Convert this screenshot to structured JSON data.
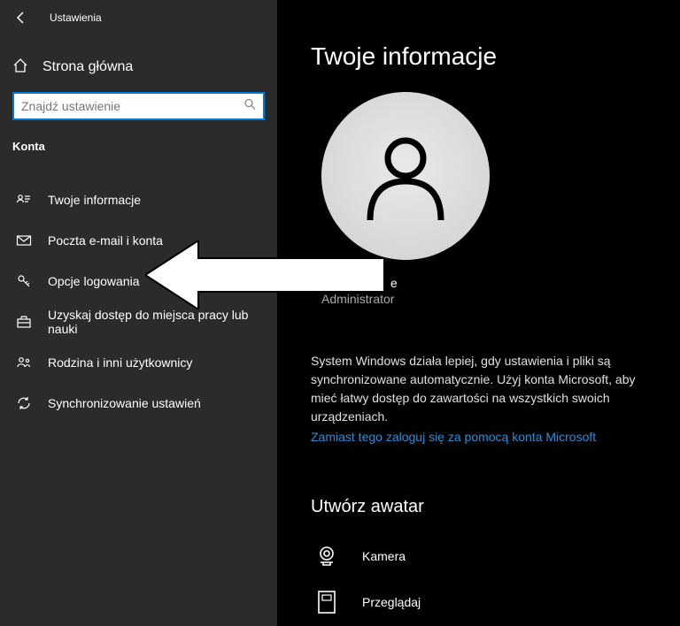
{
  "titlebar": {
    "title": "Ustawienia"
  },
  "home": {
    "label": "Strona główna"
  },
  "search": {
    "placeholder": "Znajdź ustawienie"
  },
  "category": {
    "label": "Konta"
  },
  "nav": {
    "info": "Twoje informacje",
    "email": "Poczta e-mail i konta",
    "signin": "Opcje logowania",
    "work": "Uzyskaj dostęp do miejsca pracy lub nauki",
    "family": "Rodzina i inni użytkownicy",
    "sync": "Synchronizowanie ustawień"
  },
  "main": {
    "heading": "Twoje informacje",
    "account_name_visible_suffix": "e",
    "role": "Administrator",
    "sync_text": "System Windows działa lepiej, gdy ustawienia i pliki są synchronizowane automatycznie. Użyj konta Microsoft, aby mieć łatwy dostęp do zawartości na wszystkich swoich urządzeniach.",
    "sync_link": "Zamiast tego zaloguj się za pomocą konta Microsoft",
    "create_avatar_heading": "Utwórz awatar",
    "camera_label": "Kamera",
    "browse_label": "Przeglądaj"
  }
}
